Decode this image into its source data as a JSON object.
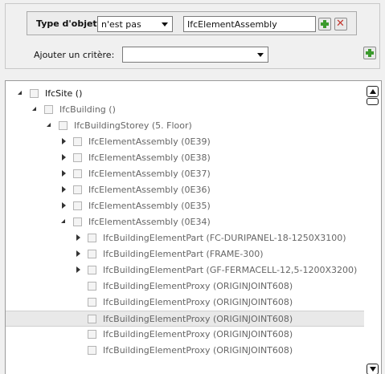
{
  "filter": {
    "type_label": "Type d'objet",
    "operator_value": "n'est pas",
    "value_text": "IfcElementAssembly",
    "add_criterion_label": "Ajouter un critère:",
    "add_criterion_value": ""
  },
  "tree": {
    "rows": [
      {
        "label": "IfcSite ()",
        "expander": "open"
      },
      {
        "label": "IfcBuilding ()",
        "expander": "open"
      },
      {
        "label": "IfcBuildingStorey (5. Floor)",
        "expander": "open"
      },
      {
        "label": "IfcElementAssembly (0E39)",
        "expander": "closed"
      },
      {
        "label": "IfcElementAssembly (0E38)",
        "expander": "closed"
      },
      {
        "label": "IfcElementAssembly (0E37)",
        "expander": "closed"
      },
      {
        "label": "IfcElementAssembly (0E36)",
        "expander": "closed"
      },
      {
        "label": "IfcElementAssembly (0E35)",
        "expander": "closed"
      },
      {
        "label": "IfcElementAssembly (0E34)",
        "expander": "open"
      },
      {
        "label": "IfcBuildingElementPart (FC-DURIPANEL-18-1250X3100)",
        "expander": "closed"
      },
      {
        "label": "IfcBuildingElementPart (FRAME-300)",
        "expander": "closed"
      },
      {
        "label": "IfcBuildingElementPart (GF-FERMACELL-12,5-1200X3200)",
        "expander": "closed"
      },
      {
        "label": "IfcBuildingElementProxy (ORIGINJOINT608)",
        "expander": "none"
      },
      {
        "label": "IfcBuildingElementProxy (ORIGINJOINT608)",
        "expander": "none"
      },
      {
        "label": "IfcBuildingElementProxy (ORIGINJOINT608)",
        "expander": "none",
        "selected": true
      },
      {
        "label": "IfcBuildingElementProxy (ORIGINJOINT608)",
        "expander": "none"
      },
      {
        "label": "IfcBuildingElementProxy (ORIGINJOINT608)",
        "expander": "none"
      }
    ]
  }
}
